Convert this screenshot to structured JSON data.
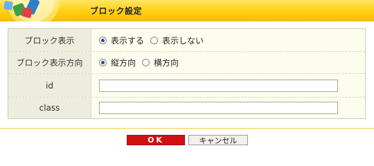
{
  "header": {
    "title": "ブロック設定"
  },
  "form": {
    "display": {
      "label": "ブロック表示",
      "options": [
        "表示する",
        "表示しない"
      ],
      "selected": "表示する"
    },
    "direction": {
      "label": "ブロック表示方向",
      "options": [
        "縦方向",
        "横方向"
      ],
      "selected": "縦方向"
    },
    "id": {
      "label": "id",
      "value": ""
    },
    "class": {
      "label": "class",
      "value": ""
    }
  },
  "buttons": {
    "ok": "OK",
    "cancel": "キャンセル"
  },
  "colors": {
    "header_gold": "#ffd21a",
    "ok_red": "#d01010",
    "label_bg": "#ededdf",
    "table_bg": "#fdfdef"
  }
}
